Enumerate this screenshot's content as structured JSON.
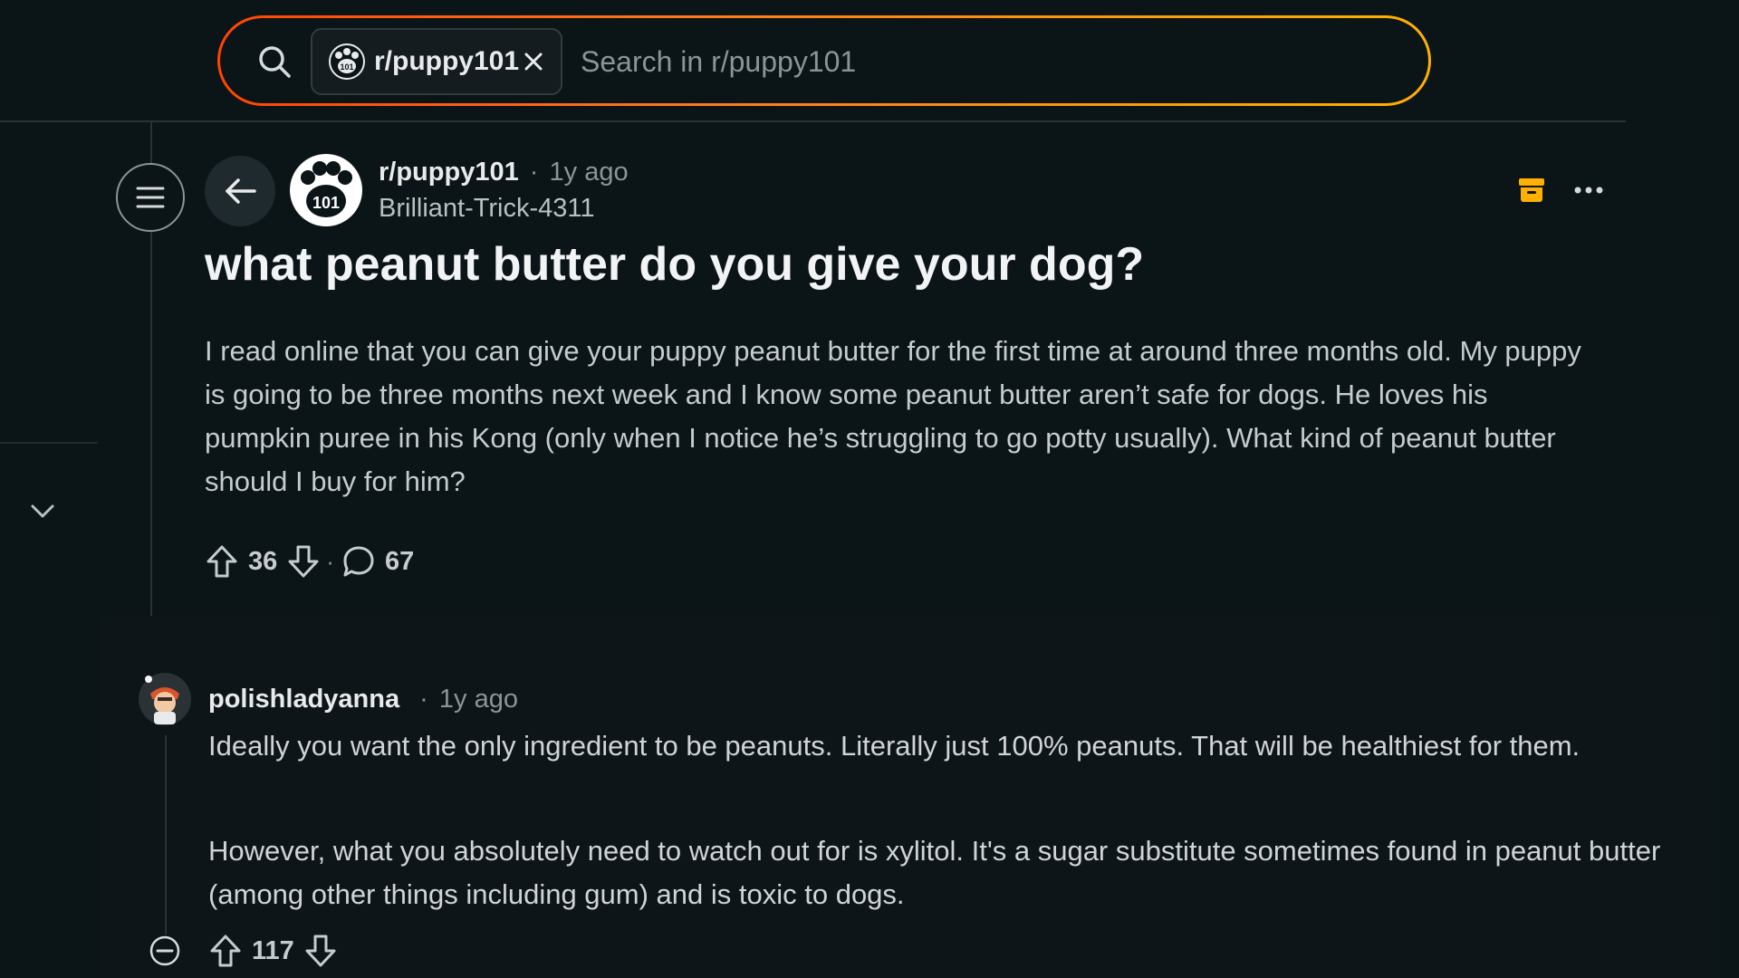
{
  "search": {
    "chip_label": "r/puppy101",
    "placeholder": "Search in r/puppy101"
  },
  "post": {
    "subreddit": "r/puppy101",
    "time": "1y ago",
    "author": "Brilliant-Trick-4311",
    "title": "what peanut butter do you give your dog?",
    "body": "I read online that you can give your puppy peanut butter for the first time at around three months old. My puppy is going to be three months next week and I know some peanut butter aren’t safe for dogs. He loves his pumpkin puree in his Kong (only when I notice he’s struggling to go potty usually). What kind of peanut butter should I buy for him?",
    "votes": "36",
    "comments": "67"
  },
  "comment": {
    "author": "polishladyanna",
    "time": "1y ago",
    "paragraph1": "Ideally you want the only ingredient to be peanuts. Literally just 100% peanuts. That will be healthiest for them.",
    "paragraph2": "However, what you absolutely need to watch out for is xylitol. It's a sugar substitute sometimes found in peanut butter (among other things including gum) and is toxic to dogs.",
    "votes": "117"
  },
  "sub_avatar_badge": "101",
  "separator": "·",
  "icons": [
    "search-icon",
    "paw-icon",
    "close-icon",
    "menu-icon",
    "back-arrow-icon",
    "archive-icon",
    "more-icon",
    "upvote-icon",
    "downvote-icon",
    "comment-icon",
    "collapse-icon",
    "chevron-down-icon"
  ],
  "colors": {
    "accent_orange": "#ff4500",
    "accent_yellow": "#ffb000",
    "background": "#0b1416"
  }
}
